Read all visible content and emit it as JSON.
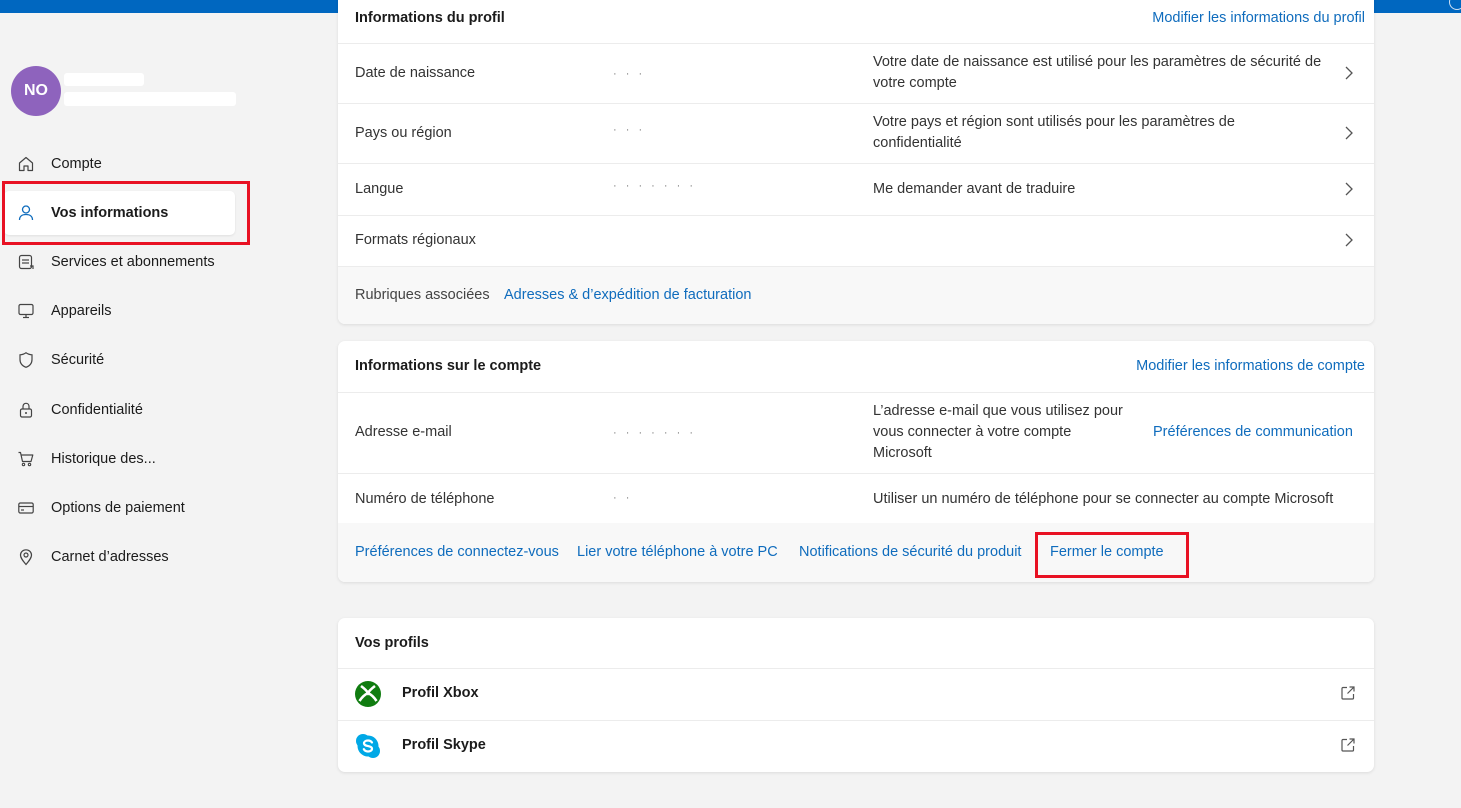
{
  "user": {
    "initials": "NO"
  },
  "sidebar": {
    "items": [
      {
        "label": "Compte",
        "icon": "home-icon"
      },
      {
        "label": "Vos informations",
        "icon": "person-icon",
        "active": true
      },
      {
        "label": "Services et abonnements",
        "icon": "subscriptions-icon"
      },
      {
        "label": "Appareils",
        "icon": "monitor-icon"
      },
      {
        "label": "Sécurité",
        "icon": "shield-icon"
      },
      {
        "label": "Confidentialité",
        "icon": "lock-icon"
      },
      {
        "label": "Historique des...",
        "icon": "cart-icon"
      },
      {
        "label": "Options de paiement",
        "icon": "card-icon"
      },
      {
        "label": "Carnet d’adresses",
        "icon": "location-pin-icon"
      }
    ]
  },
  "profile_card": {
    "title": "Informations du profil",
    "action": "Modifier les informations du profil",
    "rows": [
      {
        "label": "Date de naissance",
        "value": "· · ·",
        "desc": "Votre date de naissance est utilisé pour les paramètres de sécurité de votre compte"
      },
      {
        "label": "Pays ou région",
        "value": "·  ·  ·",
        "desc": "Votre pays et région sont utilisés pour les paramètres de confidentialité"
      },
      {
        "label": "Langue",
        "value": "·  ·  ·  ·  ·  ·  ·",
        "desc": "Me demander avant de traduire"
      },
      {
        "label": "Formats régionaux",
        "value": "",
        "desc": ""
      }
    ],
    "related_label": "Rubriques associées",
    "related_link": "Adresses & d’expédition de facturation"
  },
  "account_card": {
    "title": "Informations sur le compte",
    "action": "Modifier les informations de compte",
    "email_label": "Adresse e-mail",
    "email_value": "·  ·  ·  ·  ·  ·  ·",
    "email_desc": "L’adresse e-mail que vous utilisez pour vous connecter à votre compte Microsoft",
    "email_link": "Préférences de communication",
    "phone_label": "Numéro de téléphone",
    "phone_value": "· ·",
    "phone_desc": "Utiliser un numéro de téléphone pour se connecter au compte Microsoft",
    "footer_links": [
      "Préférences de connectez-vous",
      "Lier votre téléphone à votre PC",
      "Notifications de sécurité du produit",
      "Fermer le compte"
    ]
  },
  "profiles_card": {
    "title": "Vos profils",
    "items": [
      {
        "label": "Profil Xbox",
        "icon": "xbox-icon"
      },
      {
        "label": "Profil Skype",
        "icon": "skype-icon"
      }
    ]
  },
  "colors": {
    "accent": "#0067c0",
    "link": "#0f6cbd",
    "highlight": "#e81123",
    "avatar": "#8e63bd"
  }
}
